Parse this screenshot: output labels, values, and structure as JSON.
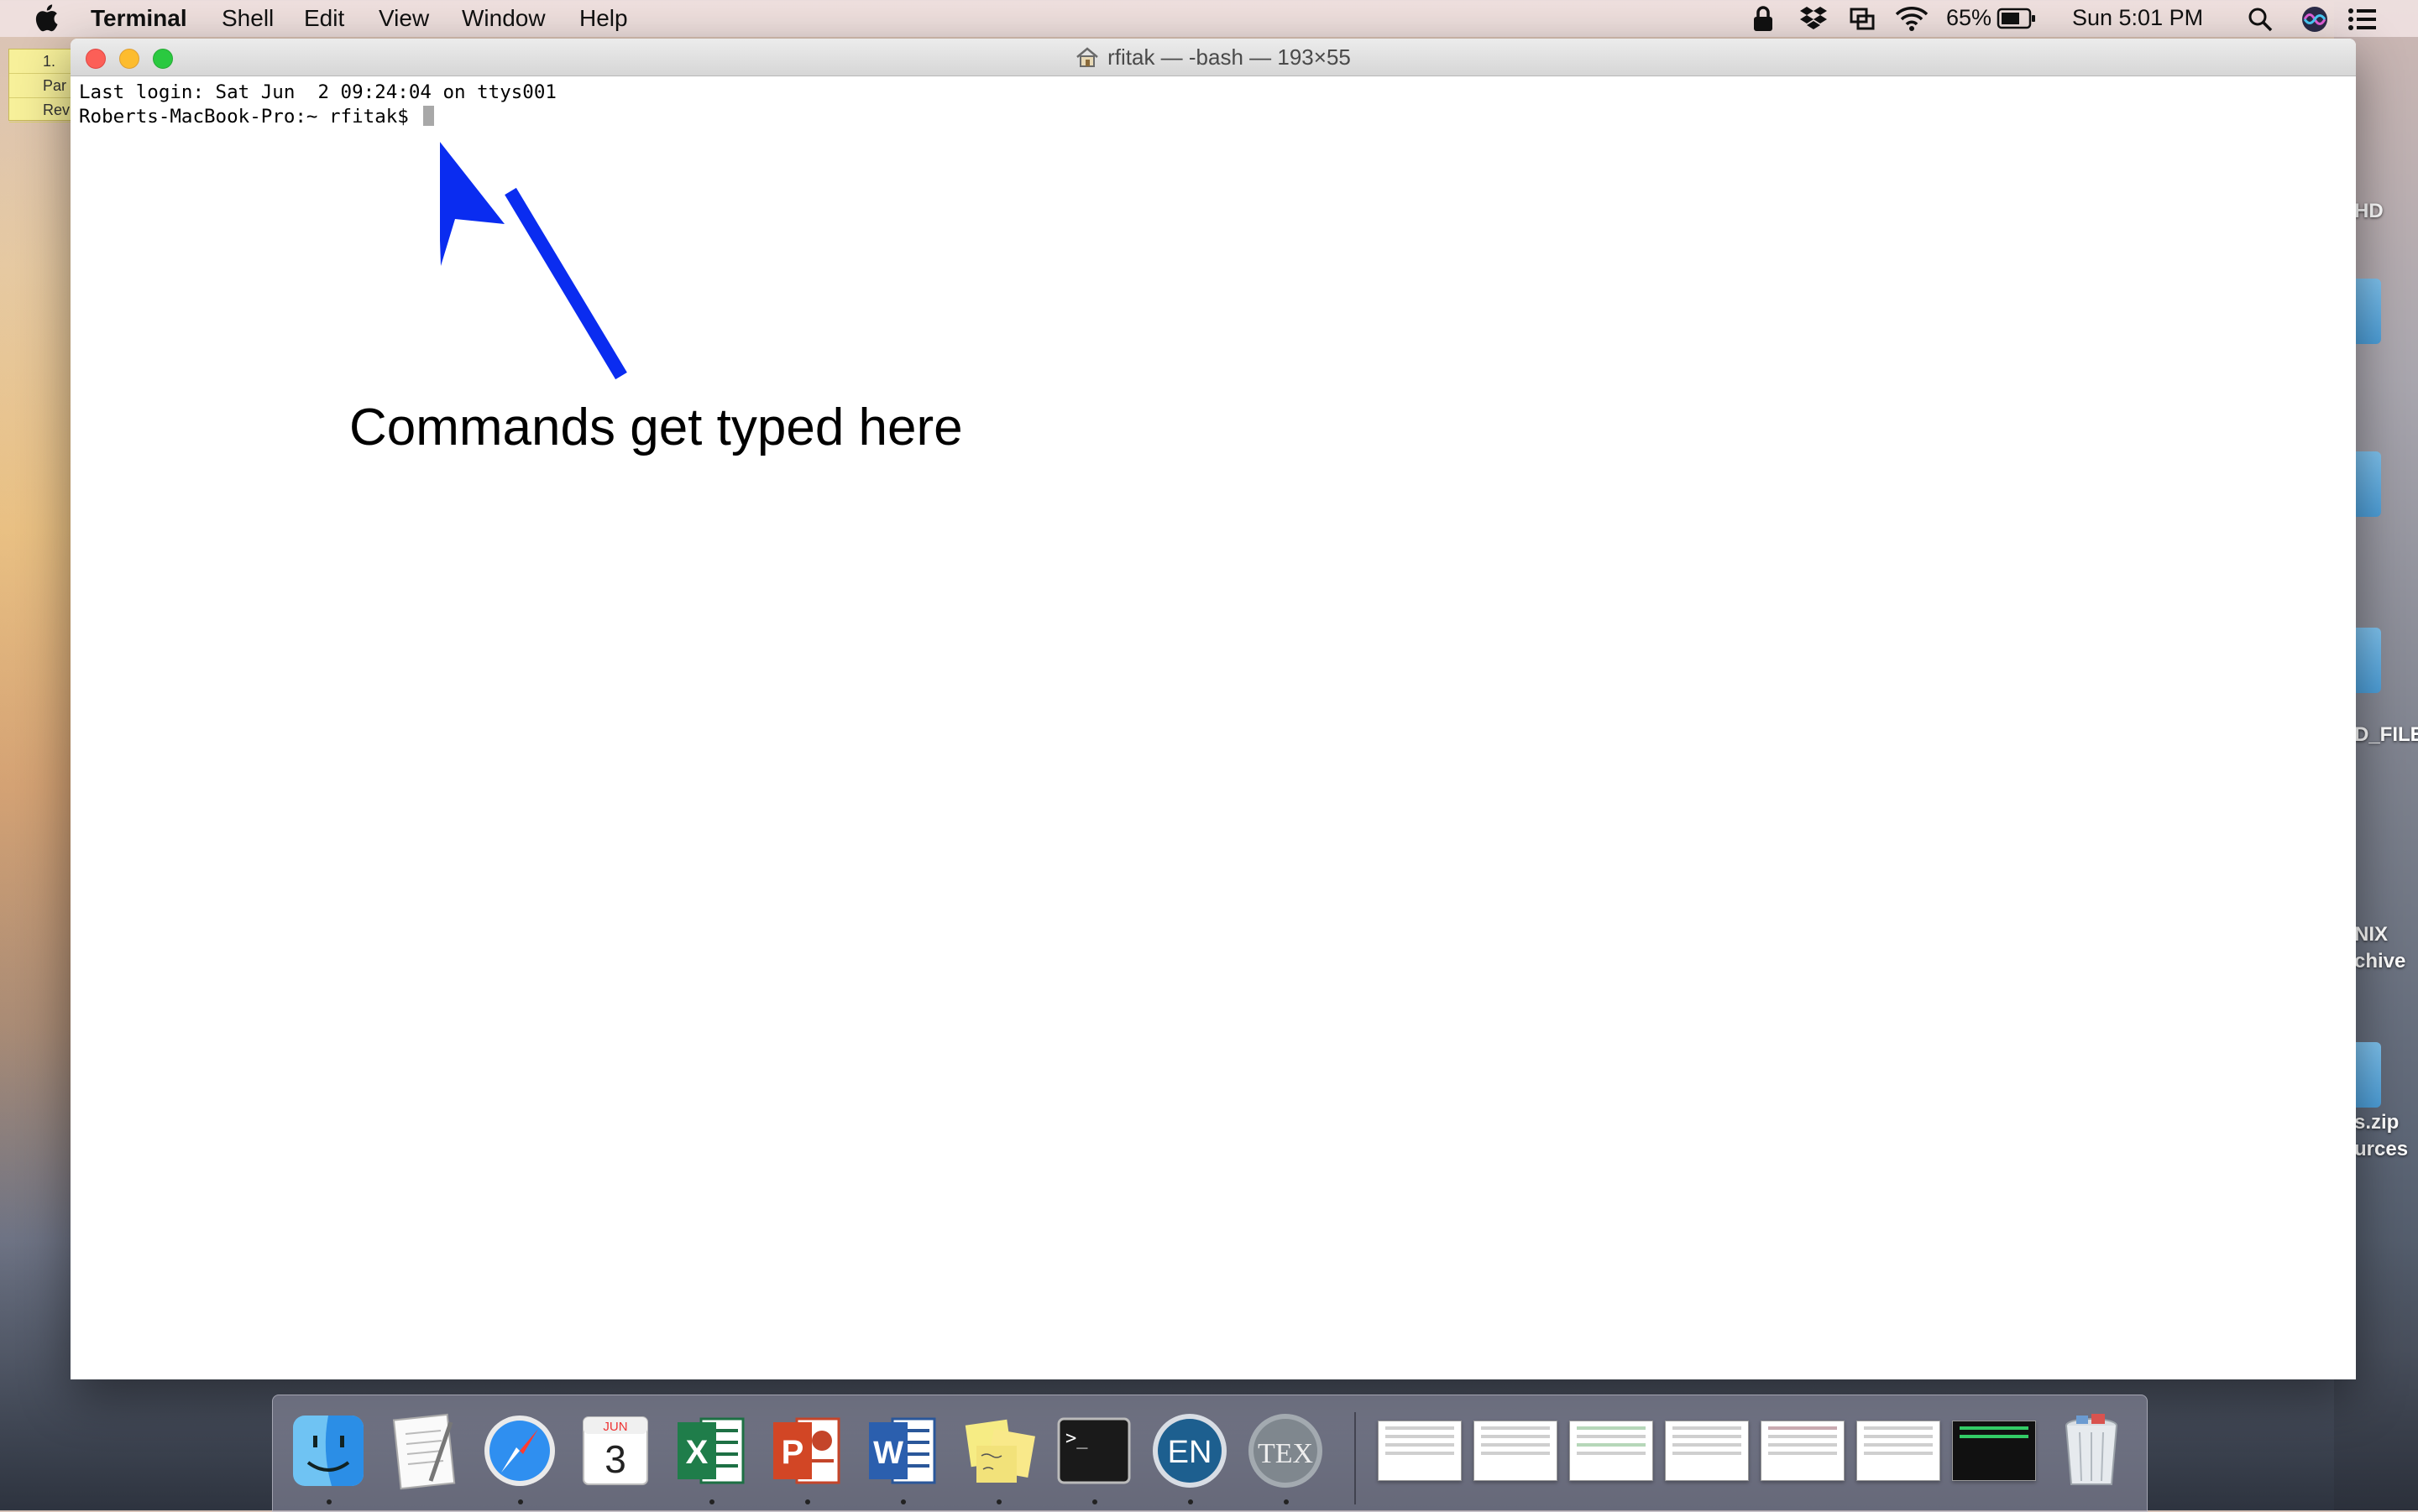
{
  "menubar": {
    "app_name": "Terminal",
    "items": [
      "Shell",
      "Edit",
      "View",
      "Window",
      "Help"
    ],
    "battery_percent": "65%",
    "clock": "Sun 5:01 PM",
    "icons": [
      "lock-icon",
      "dropbox-icon",
      "display-mirror-icon",
      "wifi-icon",
      "battery-icon",
      "spotlight-search-icon",
      "siri-icon",
      "notification-center-icon"
    ]
  },
  "sticky": {
    "lines": [
      "1.",
      "Par",
      "Rev"
    ]
  },
  "desktop_labels": [
    "HD",
    "D_FILE",
    "NIX",
    "chive",
    "s.zip",
    "urces"
  ],
  "window": {
    "title": "rfitak — -bash — 193×55",
    "lines": [
      "Last login: Sat Jun  2 09:24:04 on ttys001",
      "Roberts-MacBook-Pro:~ rfitak$ "
    ],
    "annotation": "Commands get typed here",
    "arrow_color": "#0a2cf0"
  },
  "dock": {
    "apps": [
      {
        "name": "Finder",
        "running": true
      },
      {
        "name": "TextEdit",
        "running": false
      },
      {
        "name": "Safari",
        "running": true
      },
      {
        "name": "Calendar",
        "running": false,
        "month": "JUN",
        "day": "3"
      },
      {
        "name": "Microsoft Excel",
        "running": true,
        "letter": "X"
      },
      {
        "name": "Microsoft PowerPoint",
        "running": true,
        "letter": "P"
      },
      {
        "name": "Microsoft Word",
        "running": true,
        "letter": "W"
      },
      {
        "name": "Stickies",
        "running": true
      },
      {
        "name": "Terminal",
        "running": true,
        "glyph": ">_"
      },
      {
        "name": "EndNote",
        "running": true,
        "letter": "EN"
      },
      {
        "name": "TeXShop",
        "running": true,
        "letter": "TEX"
      }
    ],
    "minimized": [
      "endnote-window",
      "finder-window",
      "excel-window",
      "tex-window",
      "safari-window",
      "finder-window-2",
      "terminal-window"
    ],
    "trash": "Trash"
  }
}
